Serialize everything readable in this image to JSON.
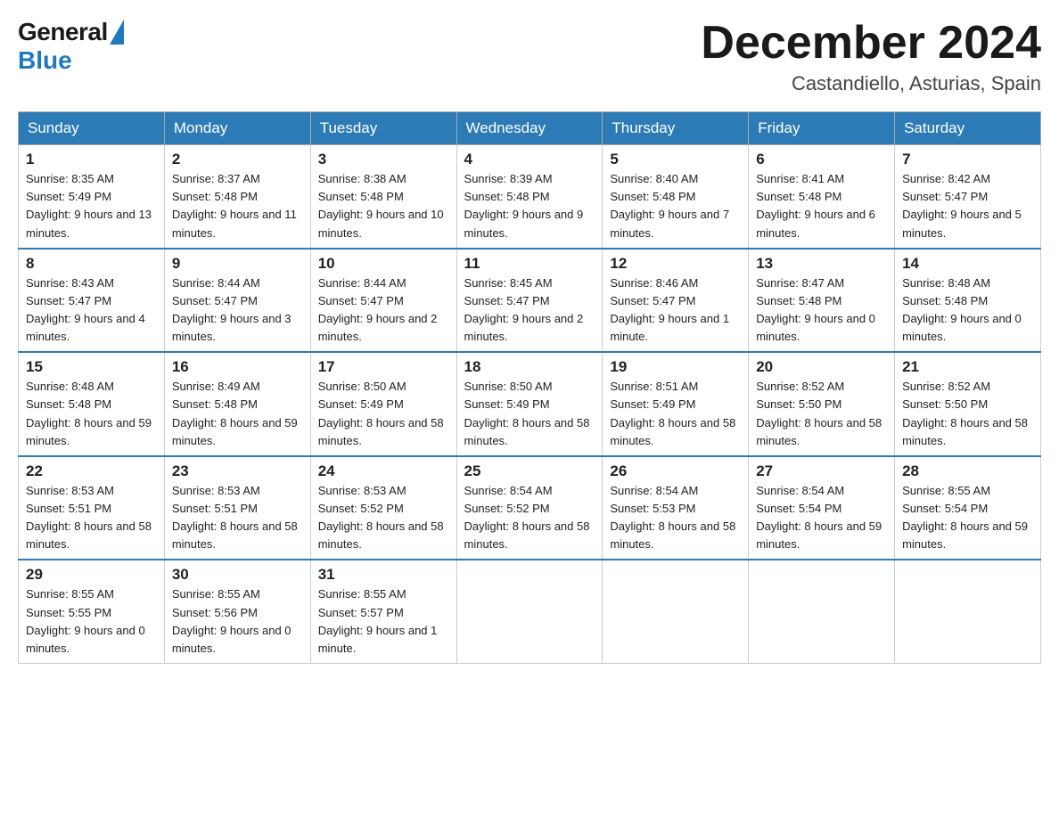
{
  "header": {
    "logo_general": "General",
    "logo_blue": "Blue",
    "month_year": "December 2024",
    "location": "Castandiello, Asturias, Spain"
  },
  "days_of_week": [
    "Sunday",
    "Monday",
    "Tuesday",
    "Wednesday",
    "Thursday",
    "Friday",
    "Saturday"
  ],
  "weeks": [
    [
      {
        "day": "1",
        "sunrise": "8:35 AM",
        "sunset": "5:49 PM",
        "daylight": "9 hours and 13 minutes."
      },
      {
        "day": "2",
        "sunrise": "8:37 AM",
        "sunset": "5:48 PM",
        "daylight": "9 hours and 11 minutes."
      },
      {
        "day": "3",
        "sunrise": "8:38 AM",
        "sunset": "5:48 PM",
        "daylight": "9 hours and 10 minutes."
      },
      {
        "day": "4",
        "sunrise": "8:39 AM",
        "sunset": "5:48 PM",
        "daylight": "9 hours and 9 minutes."
      },
      {
        "day": "5",
        "sunrise": "8:40 AM",
        "sunset": "5:48 PM",
        "daylight": "9 hours and 7 minutes."
      },
      {
        "day": "6",
        "sunrise": "8:41 AM",
        "sunset": "5:48 PM",
        "daylight": "9 hours and 6 minutes."
      },
      {
        "day": "7",
        "sunrise": "8:42 AM",
        "sunset": "5:47 PM",
        "daylight": "9 hours and 5 minutes."
      }
    ],
    [
      {
        "day": "8",
        "sunrise": "8:43 AM",
        "sunset": "5:47 PM",
        "daylight": "9 hours and 4 minutes."
      },
      {
        "day": "9",
        "sunrise": "8:44 AM",
        "sunset": "5:47 PM",
        "daylight": "9 hours and 3 minutes."
      },
      {
        "day": "10",
        "sunrise": "8:44 AM",
        "sunset": "5:47 PM",
        "daylight": "9 hours and 2 minutes."
      },
      {
        "day": "11",
        "sunrise": "8:45 AM",
        "sunset": "5:47 PM",
        "daylight": "9 hours and 2 minutes."
      },
      {
        "day": "12",
        "sunrise": "8:46 AM",
        "sunset": "5:47 PM",
        "daylight": "9 hours and 1 minute."
      },
      {
        "day": "13",
        "sunrise": "8:47 AM",
        "sunset": "5:48 PM",
        "daylight": "9 hours and 0 minutes."
      },
      {
        "day": "14",
        "sunrise": "8:48 AM",
        "sunset": "5:48 PM",
        "daylight": "9 hours and 0 minutes."
      }
    ],
    [
      {
        "day": "15",
        "sunrise": "8:48 AM",
        "sunset": "5:48 PM",
        "daylight": "8 hours and 59 minutes."
      },
      {
        "day": "16",
        "sunrise": "8:49 AM",
        "sunset": "5:48 PM",
        "daylight": "8 hours and 59 minutes."
      },
      {
        "day": "17",
        "sunrise": "8:50 AM",
        "sunset": "5:49 PM",
        "daylight": "8 hours and 58 minutes."
      },
      {
        "day": "18",
        "sunrise": "8:50 AM",
        "sunset": "5:49 PM",
        "daylight": "8 hours and 58 minutes."
      },
      {
        "day": "19",
        "sunrise": "8:51 AM",
        "sunset": "5:49 PM",
        "daylight": "8 hours and 58 minutes."
      },
      {
        "day": "20",
        "sunrise": "8:52 AM",
        "sunset": "5:50 PM",
        "daylight": "8 hours and 58 minutes."
      },
      {
        "day": "21",
        "sunrise": "8:52 AM",
        "sunset": "5:50 PM",
        "daylight": "8 hours and 58 minutes."
      }
    ],
    [
      {
        "day": "22",
        "sunrise": "8:53 AM",
        "sunset": "5:51 PM",
        "daylight": "8 hours and 58 minutes."
      },
      {
        "day": "23",
        "sunrise": "8:53 AM",
        "sunset": "5:51 PM",
        "daylight": "8 hours and 58 minutes."
      },
      {
        "day": "24",
        "sunrise": "8:53 AM",
        "sunset": "5:52 PM",
        "daylight": "8 hours and 58 minutes."
      },
      {
        "day": "25",
        "sunrise": "8:54 AM",
        "sunset": "5:52 PM",
        "daylight": "8 hours and 58 minutes."
      },
      {
        "day": "26",
        "sunrise": "8:54 AM",
        "sunset": "5:53 PM",
        "daylight": "8 hours and 58 minutes."
      },
      {
        "day": "27",
        "sunrise": "8:54 AM",
        "sunset": "5:54 PM",
        "daylight": "8 hours and 59 minutes."
      },
      {
        "day": "28",
        "sunrise": "8:55 AM",
        "sunset": "5:54 PM",
        "daylight": "8 hours and 59 minutes."
      }
    ],
    [
      {
        "day": "29",
        "sunrise": "8:55 AM",
        "sunset": "5:55 PM",
        "daylight": "9 hours and 0 minutes."
      },
      {
        "day": "30",
        "sunrise": "8:55 AM",
        "sunset": "5:56 PM",
        "daylight": "9 hours and 0 minutes."
      },
      {
        "day": "31",
        "sunrise": "8:55 AM",
        "sunset": "5:57 PM",
        "daylight": "9 hours and 1 minute."
      },
      null,
      null,
      null,
      null
    ]
  ]
}
